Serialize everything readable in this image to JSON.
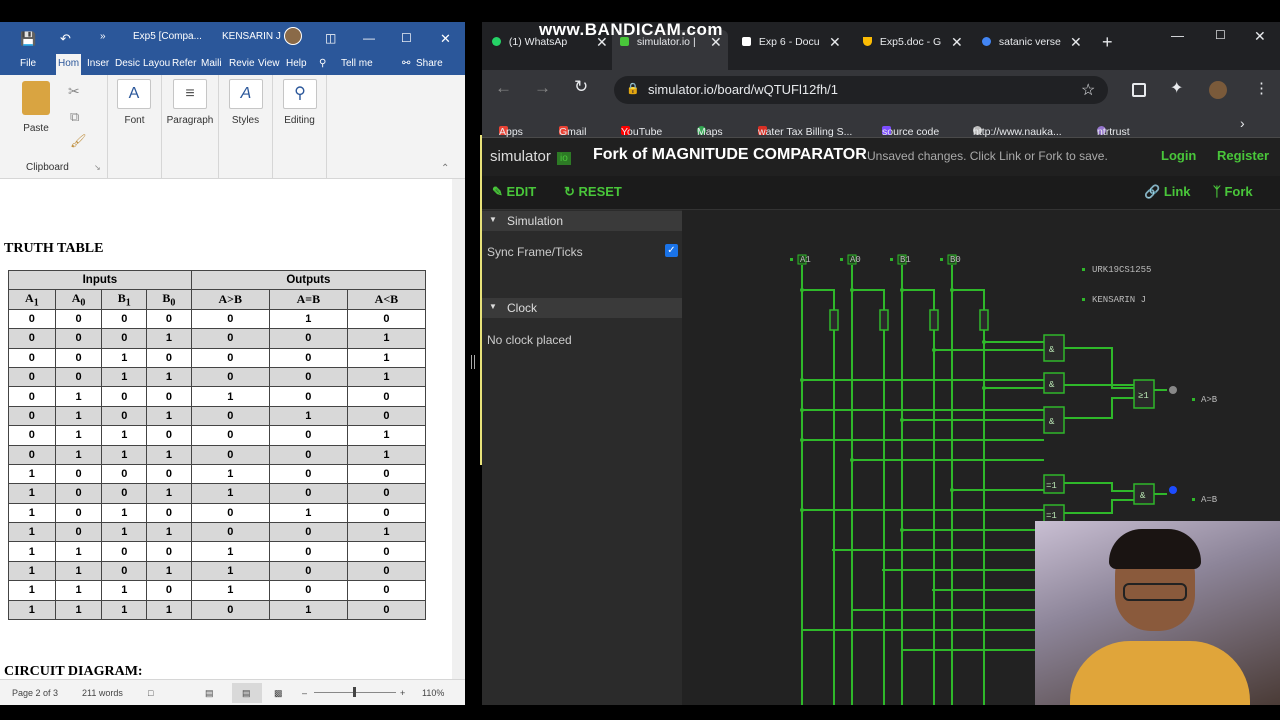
{
  "recording": {
    "watermark": "www.BANDICAM.com"
  },
  "word": {
    "title": "Exp5 [Compa...",
    "user": "KENSARIN J",
    "qat": [
      "save-icon",
      "undo-icon",
      "more-icon"
    ],
    "tabs": [
      "File",
      "Hom",
      "Inser",
      "Desic",
      "Layou",
      "Refer",
      "Maili",
      "Revie",
      "View",
      "Help"
    ],
    "tell_me": "Tell me",
    "share": "Share",
    "ribbon": {
      "paste": "Paste",
      "clipboard": "Clipboard",
      "font": "Font",
      "paragraph": "Paragraph",
      "styles": "Styles",
      "editing": "Editing"
    },
    "doc": {
      "heading1": "TRUTH TABLE",
      "heading2": "CIRCUIT DIAGRAM:",
      "table": {
        "group_headers": [
          "Inputs",
          "Outputs"
        ],
        "columns": [
          {
            "base": "A",
            "sub": "1"
          },
          {
            "base": "A",
            "sub": "0"
          },
          {
            "base": "B",
            "sub": "1"
          },
          {
            "base": "B",
            "sub": "0"
          },
          {
            "base": "A>B",
            "sub": ""
          },
          {
            "base": "A=B",
            "sub": ""
          },
          {
            "base": "A<B",
            "sub": ""
          }
        ],
        "rows": [
          [
            "0",
            "0",
            "0",
            "0",
            "0",
            "1",
            "0"
          ],
          [
            "0",
            "0",
            "0",
            "1",
            "0",
            "0",
            "1"
          ],
          [
            "0",
            "0",
            "1",
            "0",
            "0",
            "0",
            "1"
          ],
          [
            "0",
            "0",
            "1",
            "1",
            "0",
            "0",
            "1"
          ],
          [
            "0",
            "1",
            "0",
            "0",
            "1",
            "0",
            "0"
          ],
          [
            "0",
            "1",
            "0",
            "1",
            "0",
            "1",
            "0"
          ],
          [
            "0",
            "1",
            "1",
            "0",
            "0",
            "0",
            "1"
          ],
          [
            "0",
            "1",
            "1",
            "1",
            "0",
            "0",
            "1"
          ],
          [
            "1",
            "0",
            "0",
            "0",
            "1",
            "0",
            "0"
          ],
          [
            "1",
            "0",
            "0",
            "1",
            "1",
            "0",
            "0"
          ],
          [
            "1",
            "0",
            "1",
            "0",
            "0",
            "1",
            "0"
          ],
          [
            "1",
            "0",
            "1",
            "1",
            "0",
            "0",
            "1"
          ],
          [
            "1",
            "1",
            "0",
            "0",
            "1",
            "0",
            "0"
          ],
          [
            "1",
            "1",
            "0",
            "1",
            "1",
            "0",
            "0"
          ],
          [
            "1",
            "1",
            "1",
            "0",
            "1",
            "0",
            "0"
          ],
          [
            "1",
            "1",
            "1",
            "1",
            "0",
            "1",
            "0"
          ]
        ]
      }
    },
    "status": {
      "page": "Page 2 of 3",
      "words": "211 words",
      "zoom": "110%"
    }
  },
  "browser": {
    "tabs": [
      {
        "label": "(1) WhatsAp",
        "icon": "whatsapp-icon",
        "color": "#25d366"
      },
      {
        "label": "simulator.io |",
        "icon": "simulator-icon",
        "color": "#49c63a",
        "active": true
      },
      {
        "label": "Exp 6 - Docu",
        "icon": "classroom-icon",
        "color": "#ffffff"
      },
      {
        "label": "Exp5.doc - G",
        "icon": "drive-icon",
        "color": "#fbbc04"
      },
      {
        "label": "satanic verse",
        "icon": "google-icon",
        "color": "#4285f4"
      }
    ],
    "url": "simulator.io/board/wQTUFl12fh/1",
    "bookmarks": [
      {
        "label": "Apps",
        "color": "#ea4335"
      },
      {
        "label": "Gmail",
        "color": "#ea4335"
      },
      {
        "label": "YouTube",
        "color": "#ff0000"
      },
      {
        "label": "Maps",
        "color": "#34a853"
      },
      {
        "label": "water Tax Billing S...",
        "color": "#d93025"
      },
      {
        "label": "source code",
        "color": "#7c4dff"
      },
      {
        "label": "http://www.nauka...",
        "color": "#bdbdbd"
      },
      {
        "label": "ntrtrust",
        "color": "#9575cd"
      }
    ]
  },
  "simulator": {
    "brand": "simulator",
    "brand_badge": "io",
    "board_title": "Fork of MAGNITUDE COMPARATOR",
    "unsaved": "Unsaved changes. Click Link or Fork to save.",
    "login": "Login",
    "register": "Register",
    "edit": "EDIT",
    "reset": "RESET",
    "link": "Link",
    "fork": "Fork",
    "sections": {
      "simulation": "Simulation",
      "sync": "Sync Frame/Ticks",
      "clock": "Clock",
      "no_clock": "No clock placed"
    },
    "sync_checked": true,
    "inputs": [
      "A1",
      "A0",
      "B1",
      "B0"
    ],
    "labels": [
      "URK19CS1255",
      "KENSARIN J"
    ],
    "outputs": [
      "A>B",
      "A=B"
    ],
    "gates": [
      "&",
      "&",
      "&",
      "≥1",
      "=1",
      "=1",
      "&"
    ],
    "wire_color": "#2fb82a"
  }
}
